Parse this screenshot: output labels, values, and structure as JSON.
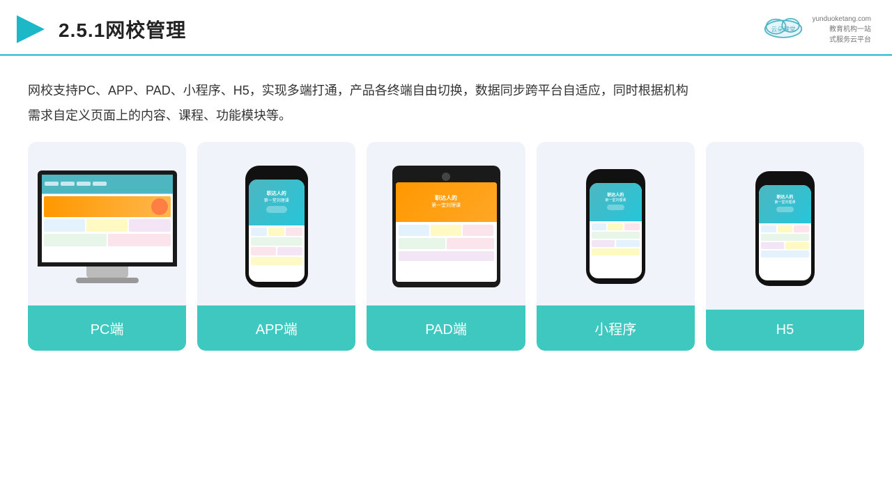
{
  "header": {
    "title": "2.5.1网校管理",
    "logo_url": "yunduoketang.com",
    "logo_brand": "云朵课堂",
    "logo_tagline": "教育机构一站\n式服务云平台"
  },
  "description": {
    "line1": "网校支持PC、APP、PAD、小程序、H5，实现多端打通，产品各终端自由切换，数据同步跨平台自适应，同时根据机构",
    "line2": "需求自定义页面上的内容、课程、功能模块等。"
  },
  "cards": [
    {
      "id": "pc",
      "label": "PC端"
    },
    {
      "id": "app",
      "label": "APP端"
    },
    {
      "id": "pad",
      "label": "PAD端"
    },
    {
      "id": "mini",
      "label": "小程序"
    },
    {
      "id": "h5",
      "label": "H5"
    }
  ]
}
